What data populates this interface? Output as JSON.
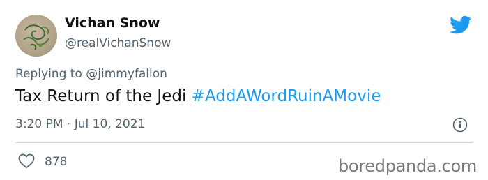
{
  "author": {
    "display_name": "Vichan Snow",
    "handle": "@realVichanSnow"
  },
  "icons": {
    "brand": "twitter-bird-icon",
    "info": "info-icon",
    "like": "heart-icon"
  },
  "colors": {
    "hashtag": "#1d9bf0",
    "bird": "#1d9bf0",
    "secondary_text": "#536471"
  },
  "reply": {
    "prefix": "Replying to",
    "mention": "@jimmyfallon"
  },
  "tweet": {
    "text": "Tax Return of the Jedi",
    "hashtag": "#AddAWordRuinAMovie",
    "timestamp": "3:20 PM · Jul 10, 2021"
  },
  "engagement": {
    "likes": "878"
  },
  "watermark": "boredpanda.com"
}
